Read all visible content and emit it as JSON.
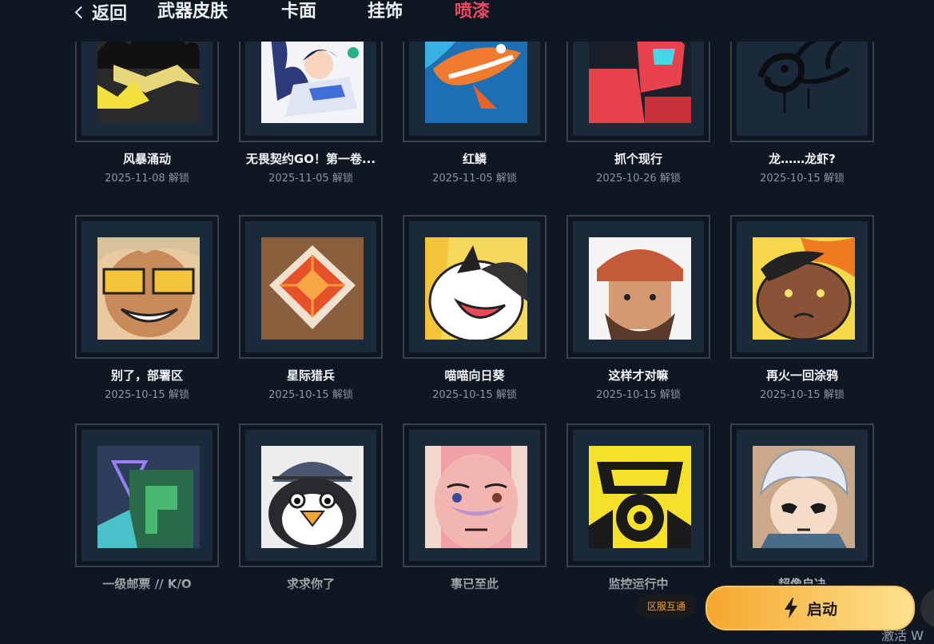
{
  "nav": {
    "back_label": "返回",
    "tabs": [
      {
        "label": "武器皮肤",
        "active": false
      },
      {
        "label": "卡面",
        "active": false
      },
      {
        "label": "挂饰",
        "active": false
      },
      {
        "label": "喷漆",
        "active": true
      }
    ]
  },
  "sprays": [
    {
      "name": "风暴涌动",
      "date": "2025-11-08 解锁"
    },
    {
      "name": "无畏契约GO！第一卷...",
      "date": "2025-11-05 解锁"
    },
    {
      "name": "红鳞",
      "date": "2025-11-05 解锁"
    },
    {
      "name": "抓个现行",
      "date": "2025-10-26 解锁"
    },
    {
      "name": "龙……龙虾?",
      "date": "2025-10-15 解锁"
    },
    {
      "name": "别了，部署区",
      "date": "2025-10-15 解锁"
    },
    {
      "name": "星际猎兵",
      "date": "2025-10-15 解锁"
    },
    {
      "name": "喵喵向日葵",
      "date": "2025-10-15 解锁"
    },
    {
      "name": "这样才对嘛",
      "date": "2025-10-15 解锁"
    },
    {
      "name": "再火一回涂鸦",
      "date": "2025-10-15 解锁"
    },
    {
      "name": "一级邮票 // K/O",
      "date": ""
    },
    {
      "name": "求求你了",
      "date": ""
    },
    {
      "name": "事已至此",
      "date": ""
    },
    {
      "name": "监控运行中",
      "date": ""
    },
    {
      "name": "超像自决",
      "date": ""
    }
  ],
  "footer": {
    "region_label": "区服互通",
    "launch_label": "启动",
    "watermark": "激活 W"
  },
  "colors": {
    "accent_active_tab": "#ec4a5e",
    "launch_gradient_start": "#f5a62c",
    "launch_gradient_end": "#fde38f",
    "background": "#0f1822"
  }
}
